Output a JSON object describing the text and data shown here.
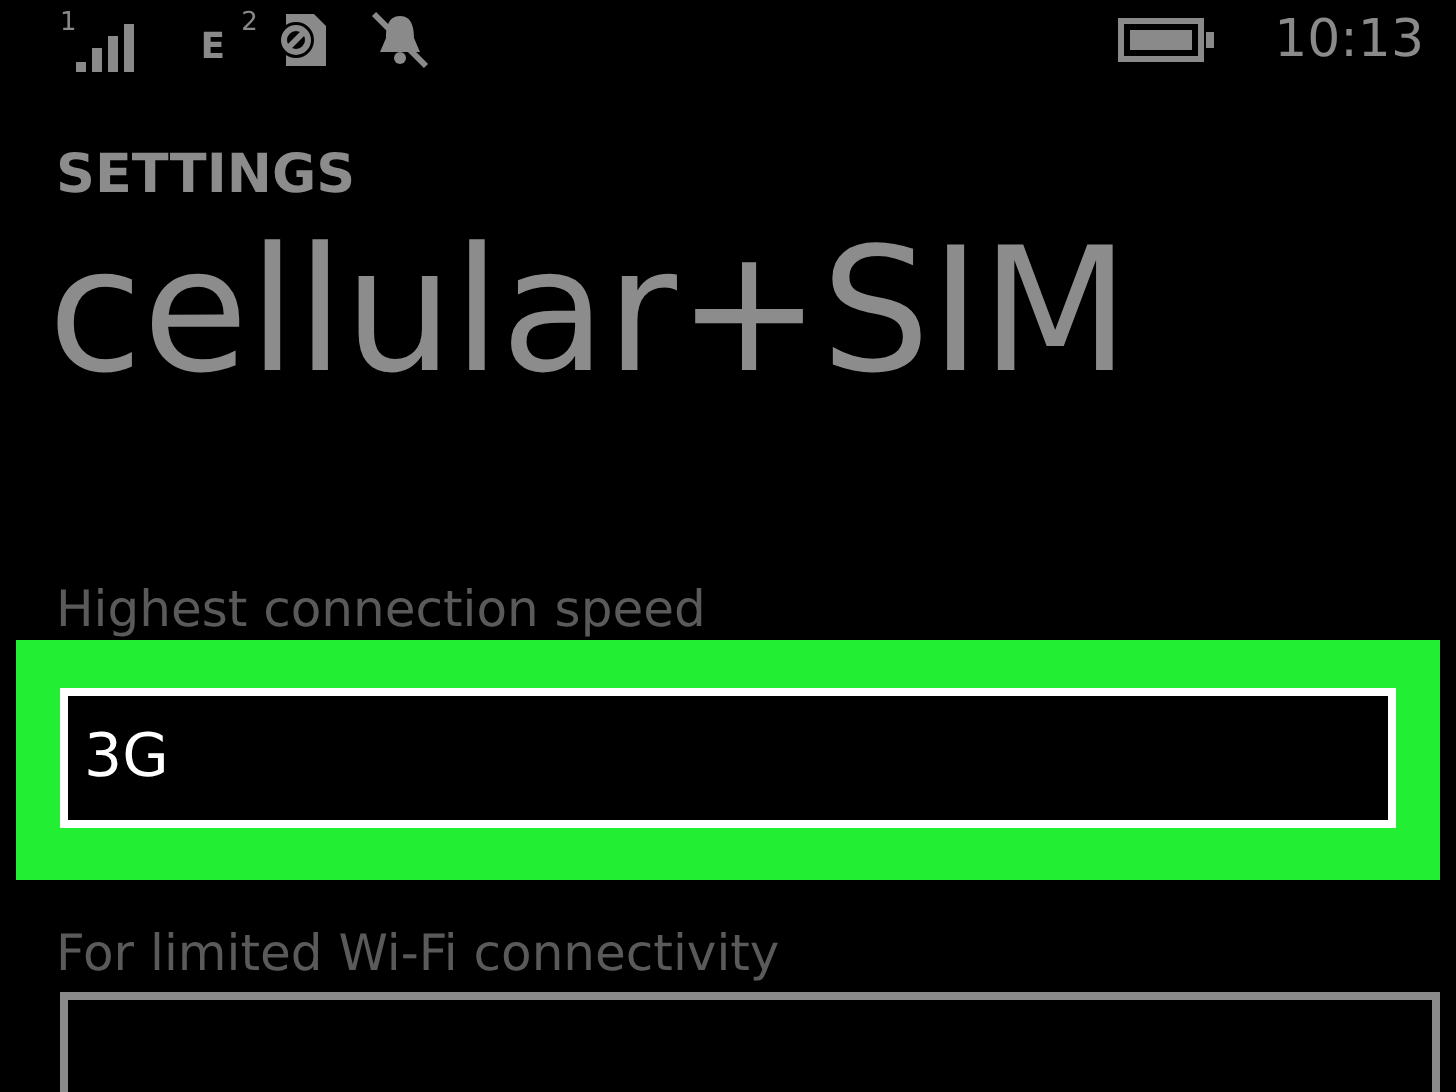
{
  "status_bar": {
    "signal_sim": "1",
    "network": "E",
    "sim_slot": "2",
    "time": "10:13"
  },
  "header": {
    "section": "SETTINGS",
    "title": "cellular+SIM"
  },
  "settings": [
    {
      "label": "Highest connection speed",
      "value": "3G",
      "highlighted": true
    },
    {
      "label": "For limited Wi-Fi connectivity",
      "highlighted": false
    }
  ]
}
